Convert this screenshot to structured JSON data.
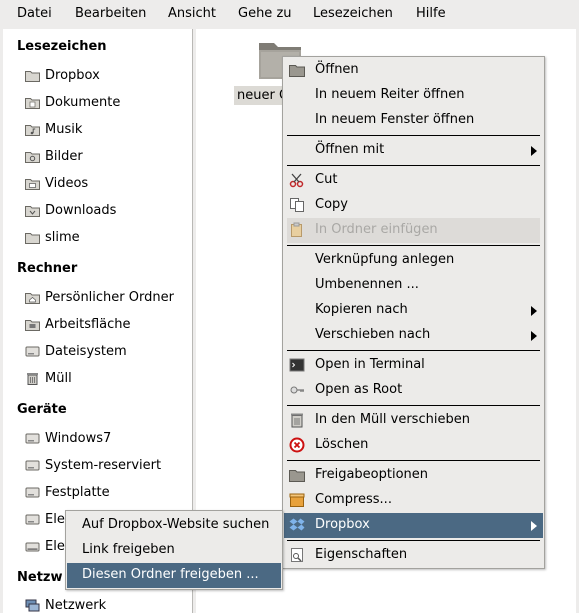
{
  "menubar": {
    "items": [
      "Datei",
      "Bearbeiten",
      "Ansicht",
      "Gehe zu",
      "Lesezeichen",
      "Hilfe"
    ]
  },
  "sidebar": {
    "sections": [
      {
        "title": "Lesezeichen",
        "items": [
          "Dropbox",
          "Dokumente",
          "Musik",
          "Bilder",
          "Videos",
          "Downloads",
          "slime"
        ]
      },
      {
        "title": "Rechner",
        "items": [
          "Persönlicher Ordner",
          "Arbeitsfläche",
          "Dateisystem",
          "Müll"
        ]
      },
      {
        "title": "Geräte",
        "items": [
          "Windows7",
          "System-reserviert",
          "Festplatte",
          "Ele",
          "Ele"
        ]
      },
      {
        "title": "Netzw",
        "items": [
          "Netzwerk"
        ]
      }
    ]
  },
  "fileview": {
    "folder_label": "neuer O"
  },
  "context_menu": {
    "items": [
      {
        "label": "Öffnen",
        "icon": "folder-icon"
      },
      {
        "label": "In neuem Reiter öffnen"
      },
      {
        "label": "In neuem Fenster öffnen"
      },
      {
        "label": "Öffnen mit",
        "submenu": true
      },
      {
        "label": "Cut",
        "icon": "scissors-icon"
      },
      {
        "label": "Copy",
        "icon": "copy-icon"
      },
      {
        "label": "In Ordner einfügen",
        "icon": "paste-icon",
        "disabled": true
      },
      {
        "label": "Verknüpfung anlegen"
      },
      {
        "label": "Umbenennen ..."
      },
      {
        "label": "Kopieren nach",
        "submenu": true
      },
      {
        "label": "Verschieben nach",
        "submenu": true
      },
      {
        "label": "Open in Terminal",
        "icon": "terminal-icon"
      },
      {
        "label": "Open as Root",
        "icon": "key-icon"
      },
      {
        "label": "In den Müll verschieben",
        "icon": "trash-icon"
      },
      {
        "label": "Löschen",
        "icon": "delete-icon"
      },
      {
        "label": "Freigabeoptionen",
        "icon": "share-folder-icon"
      },
      {
        "label": "Compress...",
        "icon": "archive-icon"
      },
      {
        "label": "Dropbox",
        "icon": "dropbox-icon",
        "submenu": true,
        "highlighted": true
      },
      {
        "label": "Eigenschaften",
        "icon": "properties-icon"
      }
    ]
  },
  "dropbox_submenu": {
    "items": [
      "Auf Dropbox-Website suchen",
      "Link freigeben",
      "Diesen Ordner freigeben ..."
    ]
  },
  "colors": {
    "highlight": "#4b6983",
    "window_bg": "#edeceb",
    "menu_bg": "#ecebe9",
    "folder_gray": "#8f8c84"
  }
}
